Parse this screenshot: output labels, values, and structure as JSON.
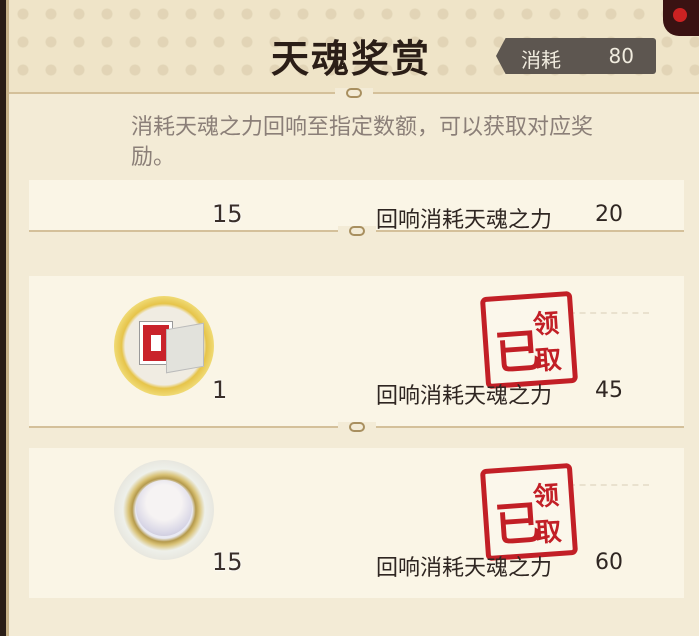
{
  "header": {
    "title": "天魂奖赏",
    "cost_label": "消耗",
    "cost_value": "80"
  },
  "description": "消耗天魂之力回响至指定数额，可以获取对应奖励。",
  "rewards": [
    {
      "icon": "character-portrait-icon",
      "count": "15",
      "requirement_label": "回响消耗天魂之力",
      "requirement_value": "20",
      "claimed": true
    },
    {
      "icon": "red-box-and-dagger-icon",
      "count": "1",
      "requirement_label": "回响消耗天魂之力",
      "requirement_value": "45",
      "claimed": true,
      "stamp": {
        "char1": "已",
        "char2": "领",
        "char3": "取"
      }
    },
    {
      "icon": "character-portrait-icon",
      "count": "15",
      "requirement_label": "回响消耗天魂之力",
      "requirement_value": "60",
      "claimed": true,
      "stamp": {
        "char1": "已",
        "char2": "领",
        "char3": "取"
      }
    }
  ],
  "colors": {
    "panel_bg": "#f3ebd6",
    "stamp_red": "#c21f26",
    "cost_box": "#5d5650"
  }
}
